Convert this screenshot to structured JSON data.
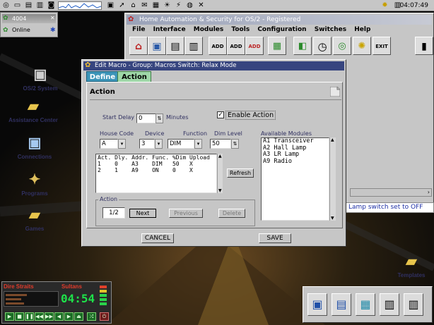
{
  "clock": "04:07:49",
  "online_window": {
    "value": "4004",
    "status": "Online"
  },
  "desktop_icons": [
    {
      "label": "OS/2 System"
    },
    {
      "label": "Assistance Center"
    },
    {
      "label": "Connections"
    },
    {
      "label": "Programs"
    },
    {
      "label": "Games"
    },
    {
      "label": "Templates"
    }
  ],
  "home_window": {
    "title": "Home Automation & Security for OS/2 - Registered",
    "menu": [
      "File",
      "Interface",
      "Modules",
      "Tools",
      "Configuration",
      "Switches",
      "Help"
    ],
    "toolbar_labels": [
      "ADD",
      "ADD",
      "ADD",
      "EXIT"
    ]
  },
  "status_message": "Lamp switch set to OFF",
  "dialog": {
    "title": "Edit Macro - Group: Macros  Switch: Relax Mode",
    "tabs": {
      "define": "Define",
      "action": "Action"
    },
    "heading": "Action",
    "start_delay_label": "Start Delay",
    "start_delay_value": "0",
    "minutes_label": "Minutes",
    "enable_action_label": "Enable Action",
    "enable_action_checked": true,
    "house_code_label": "House Code",
    "house_code_value": "A",
    "device_label": "Device",
    "device_value": "3",
    "function_label": "Function",
    "function_value": "DIM",
    "dim_level_label": "Dim Level",
    "dim_level_value": "50",
    "available_modules_label": "Available Modules",
    "modules": [
      "A1 Transceiver",
      "A2 Hall Lamp",
      "A3 LR Lamp",
      "A9 Radio"
    ],
    "list_header": "Act. Dly. Addr. Func. %Dim Upload",
    "list_rows": [
      "1    0    A3    DIM   50   X",
      "2    1    A9    ON    0    X"
    ],
    "refresh_label": "Refresh",
    "action_group_label": "Action",
    "action_counter": "1/2",
    "next_label": "Next",
    "previous_label": "Previous",
    "delete_label": "Delete",
    "cancel_label": "CANCEL",
    "save_label": "SAVE"
  },
  "player": {
    "artist": "Dire Straits",
    "track": "Sultans",
    "time": "04:54",
    "accent": "#e03b2a",
    "display_color": "#1ee24a"
  }
}
